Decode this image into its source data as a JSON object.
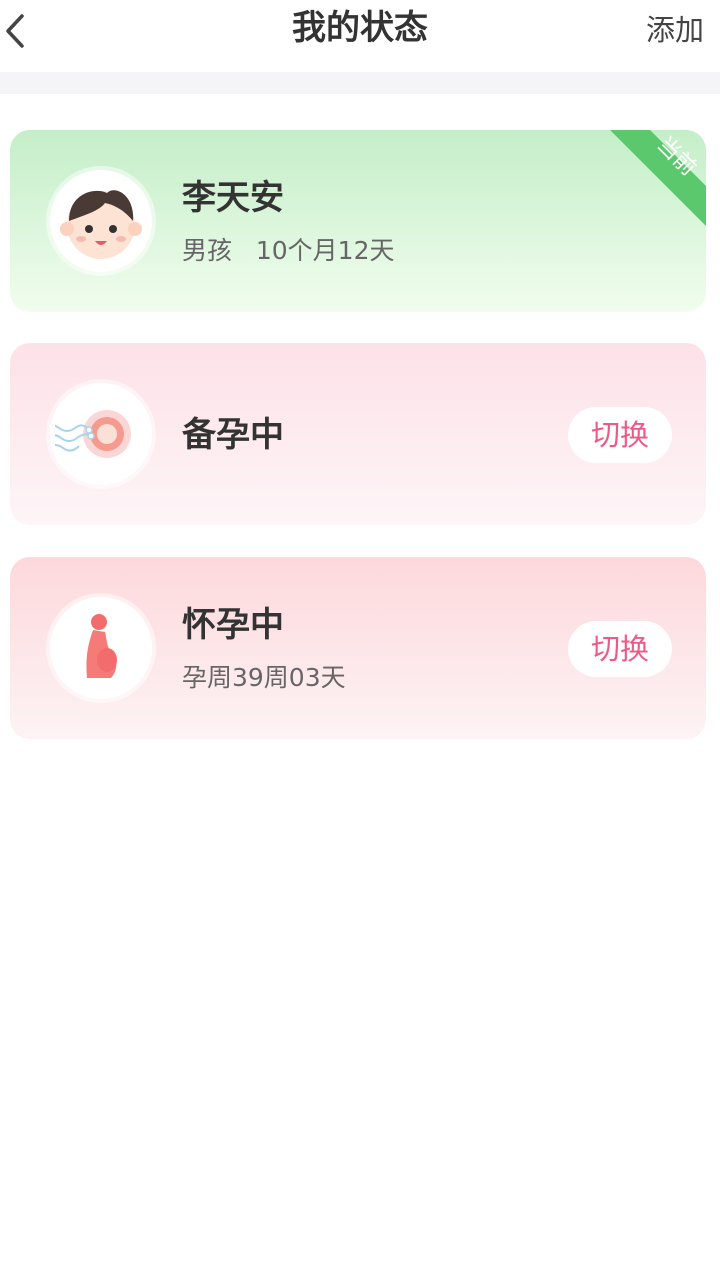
{
  "nav": {
    "title": "我的状态",
    "add_label": "添加",
    "back_icon": "chevron-left-icon"
  },
  "cards": [
    {
      "name": "李天安",
      "gender": "男孩",
      "age": "10个月12天",
      "current_label": "当前",
      "avatar_icon": "baby-face-icon",
      "accent": "#5cc86e"
    },
    {
      "name": "备孕中",
      "switch_label": "切换",
      "avatar_icon": "egg-sperm-icon",
      "accent": "#ec5b87"
    },
    {
      "name": "怀孕中",
      "detail": "孕周39周03天",
      "switch_label": "切换",
      "avatar_icon": "pregnant-woman-icon",
      "accent": "#ec5b87"
    }
  ]
}
